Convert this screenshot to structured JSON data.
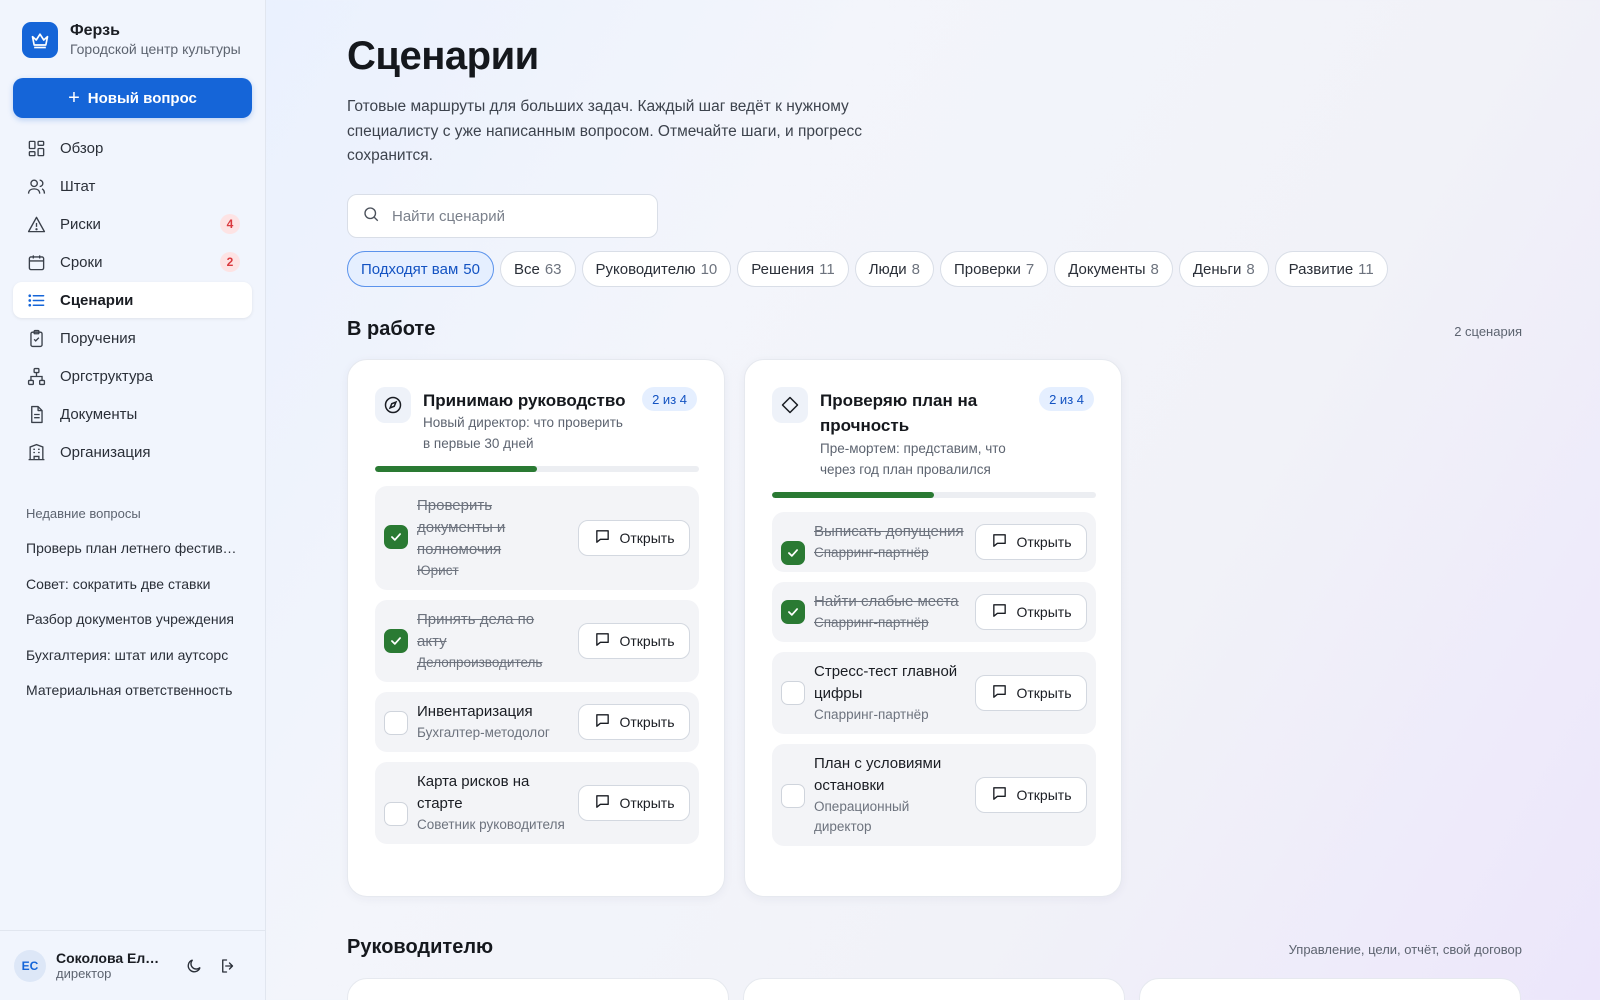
{
  "brand": {
    "name": "Ферзь",
    "subtitle": "Городской центр культуры"
  },
  "sidebar": {
    "new_button": "Новый вопрос",
    "items": [
      {
        "label": "Обзор",
        "icon": "grid-icon"
      },
      {
        "label": "Штат",
        "icon": "users-icon"
      },
      {
        "label": "Риски",
        "icon": "warning-icon",
        "badge": "4"
      },
      {
        "label": "Сроки",
        "icon": "calendar-icon",
        "badge": "2"
      },
      {
        "label": "Сценарии",
        "icon": "list-icon",
        "active": true
      },
      {
        "label": "Поручения",
        "icon": "clipboard-icon"
      },
      {
        "label": "Оргструктура",
        "icon": "org-chart-icon"
      },
      {
        "label": "Документы",
        "icon": "document-icon"
      },
      {
        "label": "Организация",
        "icon": "building-icon"
      }
    ],
    "recent_title": "Недавние вопросы",
    "recent": [
      "Проверь план летнего фестиваля",
      "Совет: сократить две ставки",
      "Разбор документов учреждения",
      "Бухгалтерия: штат или аутсорс",
      "Материальная ответственность"
    ]
  },
  "user": {
    "initials": "ЕС",
    "name": "Соколова Елена",
    "role": "директор"
  },
  "page": {
    "title": "Сценарии",
    "description": "Готовые маршруты для больших задач. Каждый шаг ведёт к нужному специалисту с уже написанным вопросом. Отмечайте шаги, и прогресс сохранится.",
    "search_placeholder": "Найти сценарий"
  },
  "filters": [
    {
      "label": "Подходят вам",
      "count": "50",
      "active": true
    },
    {
      "label": "Все",
      "count": "63"
    },
    {
      "label": "Руководителю",
      "count": "10"
    },
    {
      "label": "Решения",
      "count": "11"
    },
    {
      "label": "Люди",
      "count": "8"
    },
    {
      "label": "Проверки",
      "count": "7"
    },
    {
      "label": "Документы",
      "count": "8"
    },
    {
      "label": "Деньги",
      "count": "8"
    },
    {
      "label": "Развитие",
      "count": "11"
    }
  ],
  "in_progress": {
    "title": "В работе",
    "meta": "2 сценария",
    "cards": [
      {
        "title": "Принимаю руководство",
        "subtitle": "Новый директор: что проверить в первые 30 дней",
        "badge": "2 из 4",
        "icon": "compass-icon",
        "progress": 0.5,
        "steps": [
          {
            "name": "Проверить документы и полномочия",
            "role": "Юрист",
            "done": true,
            "button": "Открыть"
          },
          {
            "name": "Принять дела по акту",
            "role": "Делопроизводитель",
            "done": true,
            "button": "Открыть"
          },
          {
            "name": "Инвентаризация",
            "role": "Бухгалтер-методолог",
            "done": false,
            "button": "Открыть"
          },
          {
            "name": "Карта рисков на старте",
            "role": "Советник руководителя",
            "done": false,
            "button": "Открыть"
          }
        ]
      },
      {
        "title": "Проверяю план на прочность",
        "subtitle": "Пре-мортем: представим, что через год план провалился",
        "badge": "2 из 4",
        "icon": "diamond-icon",
        "progress": 0.5,
        "steps": [
          {
            "name": "Выписать допущения",
            "role": "Спарринг-партнёр",
            "done": true,
            "button": "Открыть"
          },
          {
            "name": "Найти слабые места",
            "role": "Спарринг-партнёр",
            "done": true,
            "button": "Открыть"
          },
          {
            "name": "Стресс-тест главной цифры",
            "role": "Спарринг-партнёр",
            "done": false,
            "button": "Открыть"
          },
          {
            "name": "План с условиями остановки",
            "role": "Операционный директор",
            "done": false,
            "button": "Открыть"
          }
        ]
      }
    ]
  },
  "leader_section": {
    "title": "Руководителю",
    "meta": "Управление, цели, отчёт, свой договор"
  }
}
